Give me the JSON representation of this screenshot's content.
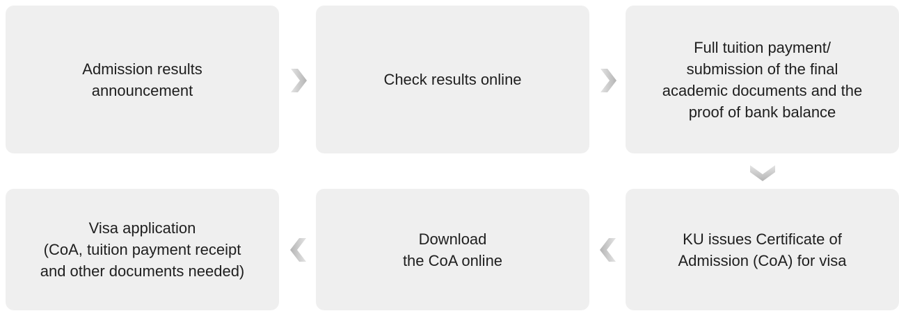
{
  "flow": {
    "steps": [
      {
        "id": 1,
        "text": "Admission results\nannouncement"
      },
      {
        "id": 2,
        "text": "Check results online"
      },
      {
        "id": 3,
        "text": "Full tuition payment/\nsubmission of the final\nacademic documents and the\nproof of bank balance"
      },
      {
        "id": 4,
        "text": "KU issues Certificate of\nAdmission (CoA) for visa"
      },
      {
        "id": 5,
        "text": "Download\nthe CoA online"
      },
      {
        "id": 6,
        "text": "Visa application\n(CoA, tuition payment receipt\nand other documents needed)"
      }
    ],
    "colors": {
      "box_fill": "#efefef",
      "text": "#1e1e1e",
      "arrow_light": "#e4e4e4",
      "arrow_dark": "#b4b4b4"
    },
    "arrows": [
      {
        "from": 1,
        "to": 2,
        "direction": "right"
      },
      {
        "from": 2,
        "to": 3,
        "direction": "right"
      },
      {
        "from": 3,
        "to": 4,
        "direction": "down"
      },
      {
        "from": 4,
        "to": 5,
        "direction": "left"
      },
      {
        "from": 5,
        "to": 6,
        "direction": "left"
      }
    ]
  }
}
